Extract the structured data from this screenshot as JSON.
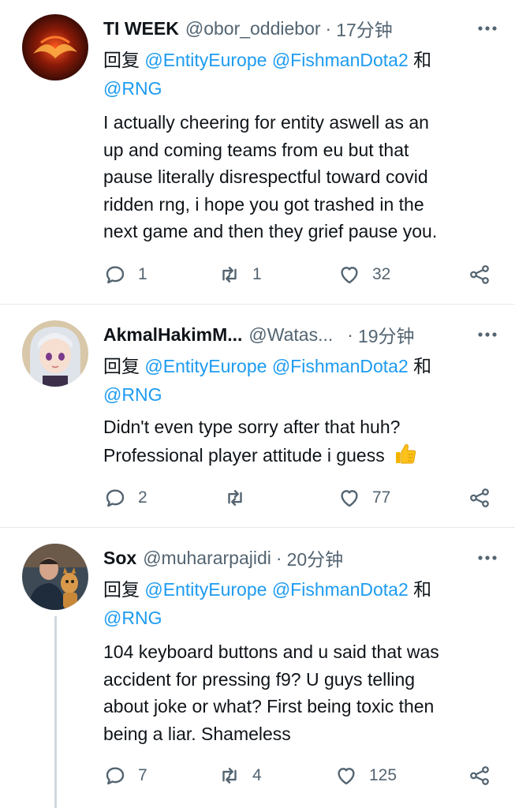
{
  "tweets": [
    {
      "name": "TI WEEK",
      "handle": "@obor_oddiebor",
      "dot": "·",
      "time": "17分钟",
      "reply_prefix": "回复",
      "mention1": "@EntityEurope",
      "mention2": "@FishmanDota2",
      "and": "和",
      "mention3": "@RNG",
      "lines": [
        "I actually cheering for entity aswell as an",
        "up and coming teams from eu but that",
        "pause literally disrespectful toward covid",
        "ridden rng, i hope you got trashed in the",
        "next game and then they grief pause you."
      ],
      "replies": "1",
      "retweets": "1",
      "likes": "32"
    },
    {
      "name": "AkmalHakimM...",
      "handle": "@Watas...",
      "dot": "·",
      "time": "19分钟",
      "reply_prefix": "回复",
      "mention1": "@EntityEurope",
      "mention2": "@FishmanDota2",
      "and": "和",
      "mention3": "@RNG",
      "lines": [
        "Didn't even type sorry after that huh?",
        "Professional player attitude i guess"
      ],
      "emoji": "thumbs-up",
      "replies": "2",
      "retweets": "",
      "likes": "77"
    },
    {
      "name": "Sox",
      "handle": "@muhararpajidi",
      "dot": "·",
      "time": "20分钟",
      "reply_prefix": "回复",
      "mention1": "@EntityEurope",
      "mention2": "@FishmanDota2",
      "and": "和",
      "mention3": "@RNG",
      "lines": [
        "104 keyboard buttons and u said that was",
        "accident for pressing f9? U guys telling",
        "about joke or what? First being toxic then",
        "being a liar. Shameless"
      ],
      "replies": "7",
      "retweets": "4",
      "likes": "125"
    }
  ],
  "icons": {
    "more": "more-dots-icon",
    "reply": "reply-bubble-icon",
    "retweet": "retweet-icon",
    "like": "heart-icon",
    "share": "share-icon"
  },
  "colors": {
    "link": "#1d9bf0",
    "secondary": "#536471",
    "text": "#0f1419",
    "divider": "#e6e9ec"
  }
}
